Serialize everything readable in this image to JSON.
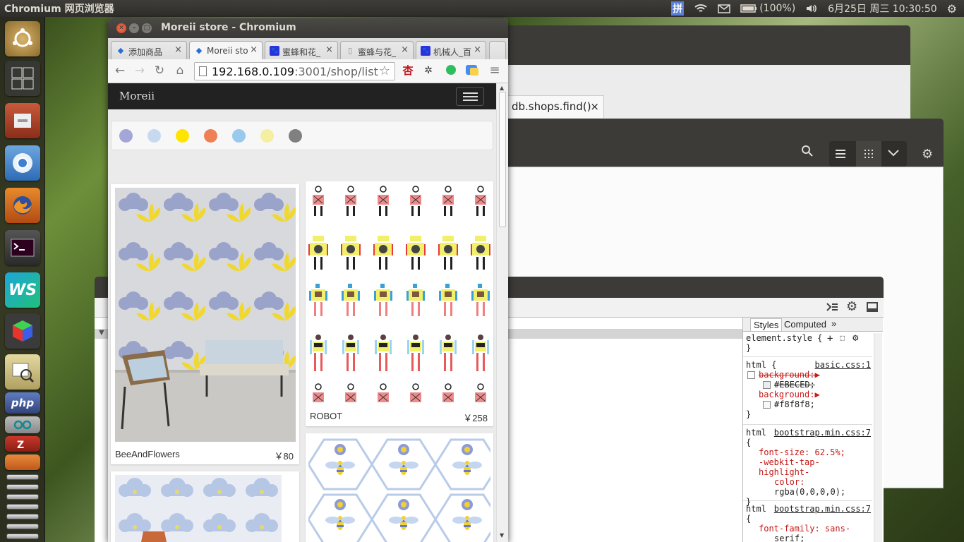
{
  "top_panel": {
    "app_name": "Chromium 网页浏览器",
    "ime": "拼",
    "battery": "(100%)",
    "datetime": "6月25日 周三  10:30:50"
  },
  "launcher": {
    "items": [
      "ubuntu-icon",
      "workspace-icon",
      "files-icon",
      "chromium-icon",
      "firefox-icon",
      "terminal-icon",
      "webstorm-icon",
      "cube-icon",
      "image-viewer-icon",
      "php-icon",
      "arduino-icon",
      "filezilla-icon",
      "stacked-app-icon"
    ],
    "php_label": "php"
  },
  "bg_windows": {
    "tab_label": "db.shops.find()",
    "tab_close": "×"
  },
  "chrome": {
    "title": "Moreii store - Chromium",
    "tabs": [
      {
        "label": "添加商品",
        "close": "×",
        "icon": "◆"
      },
      {
        "label": "Moreii sto",
        "close": "×",
        "icon": "◆"
      },
      {
        "label": "蜜蜂和花_",
        "close": "×",
        "icon": "🐾"
      },
      {
        "label": "蜜蜂与花_",
        "close": "×",
        "icon": "▯"
      },
      {
        "label": "机械人_百",
        "close": "×",
        "icon": "🐾"
      }
    ],
    "url_host": "192.168.0.109",
    "url_path": ":3001/shop/list",
    "ext_label": "杏"
  },
  "page": {
    "brand": "Moreii",
    "colors": [
      "#a3a7d8",
      "#c7d9f0",
      "#ffe400",
      "#ef8055",
      "#9ac9ee",
      "#f5efa2",
      "#808080"
    ],
    "products": [
      {
        "name": "BeeAndFlowers",
        "price": "￥80"
      },
      {
        "name": "ROBOT",
        "price": "￥258"
      }
    ]
  },
  "devtools": {
    "tabs": [
      "Styles",
      "Computed",
      "»"
    ],
    "rules": [
      {
        "selector": "element.style {",
        "lines": [
          "}"
        ]
      },
      {
        "selector": "html {",
        "source": "basic.css:1",
        "lines": [
          "background:▶",
          "#EBECED;",
          "background:▶",
          "#f8f8f8;",
          "}"
        ]
      },
      {
        "selector": "html",
        "source": "bootstrap.min.css:7",
        "lines": [
          "{",
          "font-size: 62.5%;",
          "-webkit-tap-highlight-",
          "color:",
          "rgba(0,0,0,0);",
          "}"
        ]
      },
      {
        "selector": "html",
        "source": "bootstrap.min.css:7",
        "lines": [
          "{",
          "font-family: sans-",
          "serif;"
        ]
      }
    ]
  }
}
